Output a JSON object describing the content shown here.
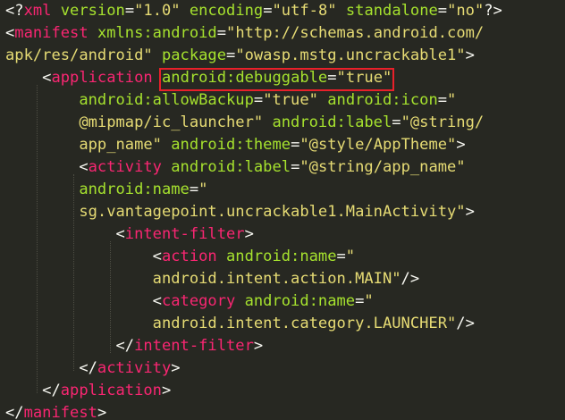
{
  "editor": {
    "lines": [
      [
        {
          "t": "<?",
          "c": "txt"
        },
        {
          "t": "xml",
          "c": "tag"
        },
        {
          "t": " ",
          "c": "txt"
        },
        {
          "t": "version",
          "c": "attr"
        },
        {
          "t": "=",
          "c": "txt"
        },
        {
          "t": "\"1.0\"",
          "c": "str"
        },
        {
          "t": " ",
          "c": "txt"
        },
        {
          "t": "encoding",
          "c": "attr"
        },
        {
          "t": "=",
          "c": "txt"
        },
        {
          "t": "\"utf-8\"",
          "c": "str"
        },
        {
          "t": " ",
          "c": "txt"
        },
        {
          "t": "standalone",
          "c": "attr"
        },
        {
          "t": "=",
          "c": "txt"
        },
        {
          "t": "\"no\"",
          "c": "str"
        },
        {
          "t": "?>",
          "c": "txt"
        }
      ],
      [
        {
          "t": "<",
          "c": "txt"
        },
        {
          "t": "manifest",
          "c": "tag"
        },
        {
          "t": " ",
          "c": "txt"
        },
        {
          "t": "xmlns:android",
          "c": "attr"
        },
        {
          "t": "=",
          "c": "txt"
        },
        {
          "t": "\"http://schemas.android.com/",
          "c": "str"
        }
      ],
      [
        {
          "t": "apk/res/android\"",
          "c": "str"
        },
        {
          "t": " ",
          "c": "txt"
        },
        {
          "t": "package",
          "c": "attr"
        },
        {
          "t": "=",
          "c": "txt"
        },
        {
          "t": "\"owasp.mstg.uncrackable1\"",
          "c": "str"
        },
        {
          "t": ">",
          "c": "txt"
        }
      ],
      [
        {
          "t": "    <",
          "c": "txt"
        },
        {
          "t": "application",
          "c": "tag"
        },
        {
          "t": " ",
          "c": "txt"
        },
        {
          "t": "android:debuggable",
          "c": "attr",
          "id": "hl-start"
        },
        {
          "t": "=",
          "c": "txt"
        },
        {
          "t": "\"true\"",
          "c": "str",
          "id": "hl-end"
        }
      ],
      [
        {
          "t": "        ",
          "c": "txt"
        },
        {
          "t": "android:allowBackup",
          "c": "attr"
        },
        {
          "t": "=",
          "c": "txt"
        },
        {
          "t": "\"true\"",
          "c": "str"
        },
        {
          "t": " ",
          "c": "txt"
        },
        {
          "t": "android:icon",
          "c": "attr"
        },
        {
          "t": "=",
          "c": "txt"
        },
        {
          "t": "\"",
          "c": "str"
        }
      ],
      [
        {
          "t": "        ",
          "c": "txt"
        },
        {
          "t": "@mipmap/ic_launcher\"",
          "c": "str"
        },
        {
          "t": " ",
          "c": "txt"
        },
        {
          "t": "android:label",
          "c": "attr"
        },
        {
          "t": "=",
          "c": "txt"
        },
        {
          "t": "\"@string/",
          "c": "str"
        }
      ],
      [
        {
          "t": "        ",
          "c": "txt"
        },
        {
          "t": "app_name\"",
          "c": "str"
        },
        {
          "t": " ",
          "c": "txt"
        },
        {
          "t": "android:theme",
          "c": "attr"
        },
        {
          "t": "=",
          "c": "txt"
        },
        {
          "t": "\"@style/AppTheme\"",
          "c": "str"
        },
        {
          "t": ">",
          "c": "txt"
        }
      ],
      [
        {
          "t": "        <",
          "c": "txt"
        },
        {
          "t": "activity",
          "c": "tag"
        },
        {
          "t": " ",
          "c": "txt"
        },
        {
          "t": "android:label",
          "c": "attr"
        },
        {
          "t": "=",
          "c": "txt"
        },
        {
          "t": "\"@string/app_name\"",
          "c": "str"
        }
      ],
      [
        {
          "t": "        ",
          "c": "txt"
        },
        {
          "t": "android:name",
          "c": "attr"
        },
        {
          "t": "=",
          "c": "txt"
        },
        {
          "t": "\"",
          "c": "str"
        }
      ],
      [
        {
          "t": "        ",
          "c": "txt"
        },
        {
          "t": "sg.vantagepoint.uncrackable1.MainActivity\"",
          "c": "str"
        },
        {
          "t": ">",
          "c": "txt"
        }
      ],
      [
        {
          "t": "            <",
          "c": "txt"
        },
        {
          "t": "intent-filter",
          "c": "tag"
        },
        {
          "t": ">",
          "c": "txt"
        }
      ],
      [
        {
          "t": "                <",
          "c": "txt"
        },
        {
          "t": "action",
          "c": "tag"
        },
        {
          "t": " ",
          "c": "txt"
        },
        {
          "t": "android:name",
          "c": "attr"
        },
        {
          "t": "=",
          "c": "txt"
        },
        {
          "t": "\"",
          "c": "str"
        }
      ],
      [
        {
          "t": "                ",
          "c": "txt"
        },
        {
          "t": "android.intent.action.MAIN\"",
          "c": "str"
        },
        {
          "t": "/>",
          "c": "txt"
        }
      ],
      [
        {
          "t": "                <",
          "c": "txt"
        },
        {
          "t": "category",
          "c": "tag"
        },
        {
          "t": " ",
          "c": "txt"
        },
        {
          "t": "android:name",
          "c": "attr"
        },
        {
          "t": "=",
          "c": "txt"
        },
        {
          "t": "\"",
          "c": "str"
        }
      ],
      [
        {
          "t": "                ",
          "c": "txt"
        },
        {
          "t": "android.intent.category.LAUNCHER\"",
          "c": "str"
        },
        {
          "t": "/>",
          "c": "txt"
        }
      ],
      [
        {
          "t": "            </",
          "c": "txt"
        },
        {
          "t": "intent-filter",
          "c": "tag"
        },
        {
          "t": ">",
          "c": "txt"
        }
      ],
      [
        {
          "t": "        </",
          "c": "txt"
        },
        {
          "t": "activity",
          "c": "tag"
        },
        {
          "t": ">",
          "c": "txt"
        }
      ],
      [
        {
          "t": "    </",
          "c": "txt"
        },
        {
          "t": "application",
          "c": "tag"
        },
        {
          "t": ">",
          "c": "txt"
        }
      ],
      [
        {
          "t": "</",
          "c": "txt"
        },
        {
          "t": "manifest",
          "c": "tag"
        },
        {
          "t": ">",
          "c": "txt"
        }
      ]
    ]
  },
  "colors": {
    "background": "#272822",
    "text": "#f8f8f2",
    "tag": "#f92672",
    "attribute": "#a6e22e",
    "string": "#e6db74",
    "highlight_box": "#e8202a"
  }
}
